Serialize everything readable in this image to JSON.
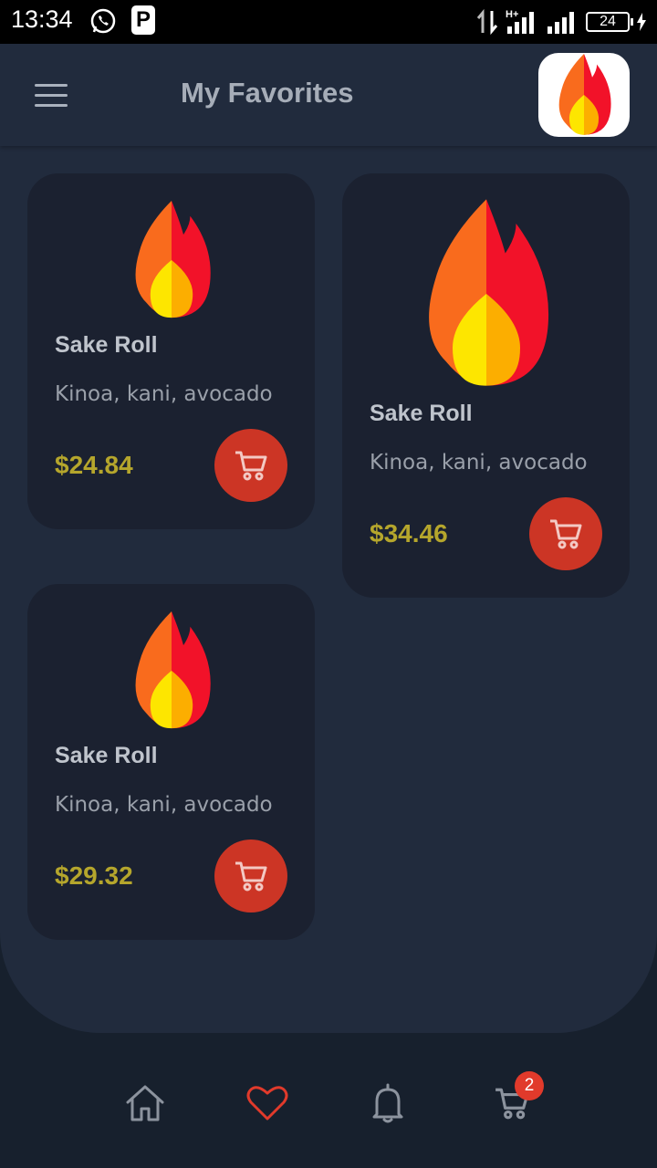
{
  "status_bar": {
    "time": "13:34",
    "network": "H+",
    "battery": "24"
  },
  "app_bar": {
    "title": "My Favorites",
    "menu_icon": "hamburger-menu-icon",
    "logo_icon": "flame-logo-icon"
  },
  "products": [
    {
      "name": "Sake Roll",
      "description": "Kinoa, kani, avocado",
      "price": "$24.84",
      "icon": "flame-icon"
    },
    {
      "name": "Sake Roll",
      "description": "Kinoa, kani, avocado",
      "price": "$34.46",
      "icon": "flame-icon"
    },
    {
      "name": "Sake Roll",
      "description": "Kinoa, kani, avocado",
      "price": "$29.32",
      "icon": "flame-icon"
    }
  ],
  "bottom_nav": {
    "items": [
      "home-icon",
      "heart-icon",
      "bell-icon",
      "cart-icon"
    ],
    "active": "heart-icon",
    "cart_badge": "2"
  },
  "colors": {
    "background": "#212b3d",
    "card": "#1b2130",
    "accent_red": "#cc3525",
    "price": "#b5a62c",
    "active_nav": "#e13a2b"
  }
}
